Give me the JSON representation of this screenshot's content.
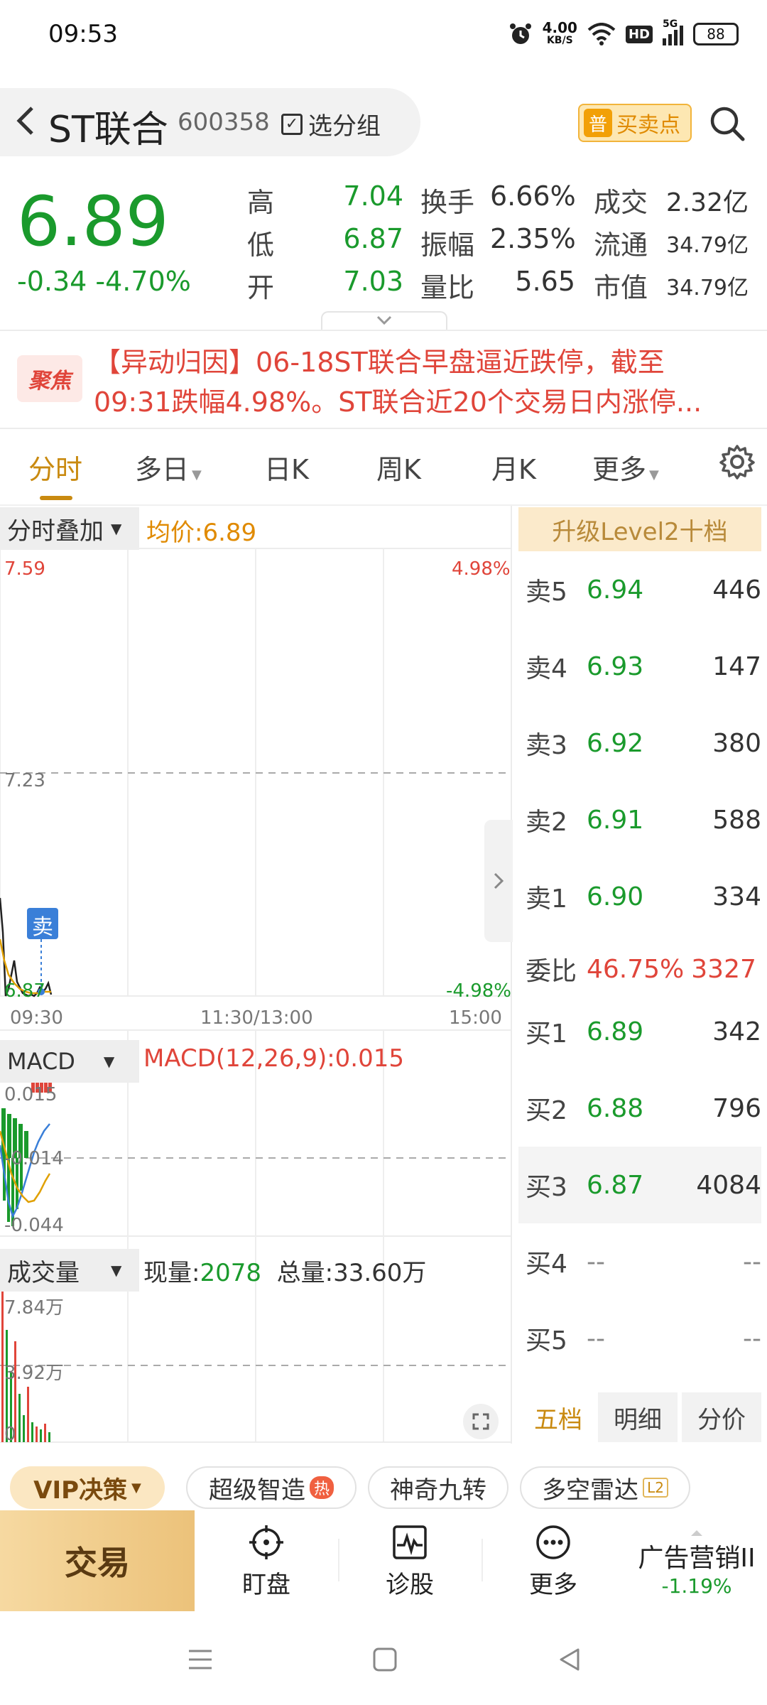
{
  "status_bar": {
    "time": "09:53",
    "speed": "4.00",
    "speed_unit": "KB/S",
    "hd": "HD",
    "net": "5G",
    "battery": "88"
  },
  "header": {
    "name": "ST联合",
    "code": "600358",
    "group_label": "选分组",
    "buysell_badge": "普",
    "buysell_label": "买卖点"
  },
  "quote": {
    "price": "6.89",
    "change": "-0.34",
    "change_pct": "-4.70%",
    "stats": [
      {
        "label": "高",
        "value": "7.04"
      },
      {
        "label": "换手",
        "value": "6.66%"
      },
      {
        "label": "成交",
        "value": "2.32亿"
      },
      {
        "label": "低",
        "value": "6.87"
      },
      {
        "label": "振幅",
        "value": "2.35%"
      },
      {
        "label": "流通",
        "value": "34.79亿"
      },
      {
        "label": "开",
        "value": "7.03"
      },
      {
        "label": "量比",
        "value": "5.65"
      },
      {
        "label": "市值",
        "value": "34.79亿"
      }
    ]
  },
  "news": {
    "badge": "聚焦",
    "line1": "【异动归因】06-18ST联合早盘逼近跌停，截至",
    "line2": "09:31跌幅4.98%。ST联合近20个交易日内涨停..."
  },
  "tabs": [
    {
      "label": "分时"
    },
    {
      "label": "多日"
    },
    {
      "label": "日K"
    },
    {
      "label": "周K"
    },
    {
      "label": "月K"
    },
    {
      "label": "更多"
    }
  ],
  "intraday": {
    "overlay_label": "分时叠加",
    "avg_label": "均价:",
    "avg_value": "6.89",
    "y_top": "7.59",
    "y_mid": "7.23",
    "y_bot": "6.87",
    "pct_top": "4.98%",
    "pct_bot": "-4.98%",
    "x_start": "09:30",
    "x_mid": "11:30/13:00",
    "x_end": "15:00",
    "sell_marker": "卖",
    "colors": {
      "price_line": "#222222",
      "avg_line": "#e0a000",
      "up": "#e0453a",
      "down": "#1a9a2c"
    }
  },
  "macd": {
    "label": "MACD",
    "text": "MACD(12,26,9):0.015",
    "y_top": "0.015",
    "y_mid": "-0.014",
    "y_bot": "-0.044"
  },
  "volume": {
    "label": "成交量",
    "now_label": "现量:",
    "now_value": "2078",
    "total_label": "总量:",
    "total_value": "33.60万",
    "y_top": "7.84万",
    "y_mid": "3.92万",
    "y_bot": "0"
  },
  "orderbook": {
    "upgrade_label": "升级Level2十档",
    "asks": [
      {
        "label": "卖5",
        "price": "6.94",
        "vol": "446"
      },
      {
        "label": "卖4",
        "price": "6.93",
        "vol": "147"
      },
      {
        "label": "卖3",
        "price": "6.92",
        "vol": "380"
      },
      {
        "label": "卖2",
        "price": "6.91",
        "vol": "588"
      },
      {
        "label": "卖1",
        "price": "6.90",
        "vol": "334"
      }
    ],
    "ratio_label": "委比",
    "ratio_value": "46.75%",
    "ratio_diff": "3327",
    "bids": [
      {
        "label": "买1",
        "price": "6.89",
        "vol": "342"
      },
      {
        "label": "买2",
        "price": "6.88",
        "vol": "796"
      },
      {
        "label": "买3",
        "price": "6.87",
        "vol": "4084"
      },
      {
        "label": "买4",
        "price": "--",
        "vol": "--"
      },
      {
        "label": "买5",
        "price": "--",
        "vol": "--"
      }
    ],
    "tabs": [
      {
        "label": "五档"
      },
      {
        "label": "明细"
      },
      {
        "label": "分价"
      }
    ]
  },
  "features": {
    "vip": "VIP决策",
    "items": [
      {
        "label": "超级智造"
      },
      {
        "label": "神奇九转"
      },
      {
        "label": "多空雷达"
      }
    ],
    "hot": "热",
    "l2": "L2"
  },
  "bottom_nav": {
    "trade": "交易",
    "items": [
      {
        "label": "盯盘"
      },
      {
        "label": "诊股"
      },
      {
        "label": "更多"
      }
    ],
    "ad_name": "广告营销II",
    "ad_change": "-1.19%"
  }
}
